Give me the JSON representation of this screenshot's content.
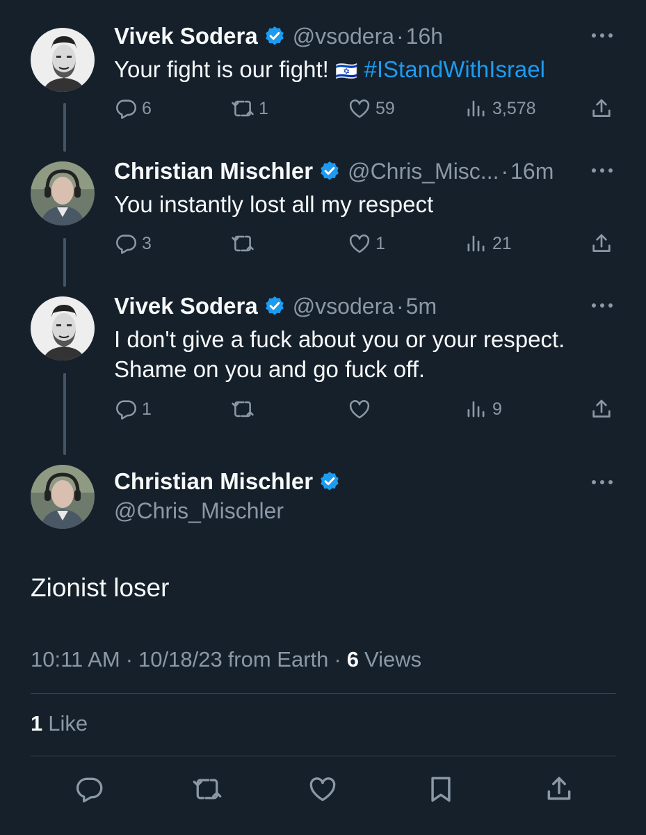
{
  "tweets": [
    {
      "name": "Vivek Sodera",
      "handle": "@vsodera",
      "time": "16h",
      "text_before": "Your fight is our fight! ",
      "flag": "🇮🇱",
      "hashtag": "#IStandWithIsrael",
      "replies": "6",
      "retweets": "1",
      "likes": "59",
      "views": "3,578"
    },
    {
      "name": "Christian Mischler",
      "handle": "@Chris_Misc...",
      "time": "16m",
      "text": "You instantly lost all my respect",
      "replies": "3",
      "retweets": "",
      "likes": "1",
      "views": "21"
    },
    {
      "name": "Vivek Sodera",
      "handle": "@vsodera",
      "time": "5m",
      "text_line1": "I don't give a fuck about you or your respect.",
      "text_line2": "Shame on you and go fuck off.",
      "replies": "1",
      "retweets": "",
      "likes": "",
      "views": "9"
    }
  ],
  "main": {
    "name": "Christian Mischler",
    "handle": "@Chris_Mischler",
    "text": "Zionist loser",
    "time": "10:11 AM",
    "date": "10/18/23",
    "source": "from Earth",
    "views_count": "6",
    "views_label": "Views",
    "likes_count": "1",
    "likes_label": "Like"
  },
  "separator": "·",
  "colors": {
    "background": "#15202b",
    "accent": "#1d9bf0",
    "secondary": "#8b98a5"
  },
  "icons": [
    "verified-badge-icon",
    "reply-icon",
    "retweet-icon",
    "like-icon",
    "views-icon",
    "share-icon",
    "more-icon",
    "bookmark-icon"
  ]
}
